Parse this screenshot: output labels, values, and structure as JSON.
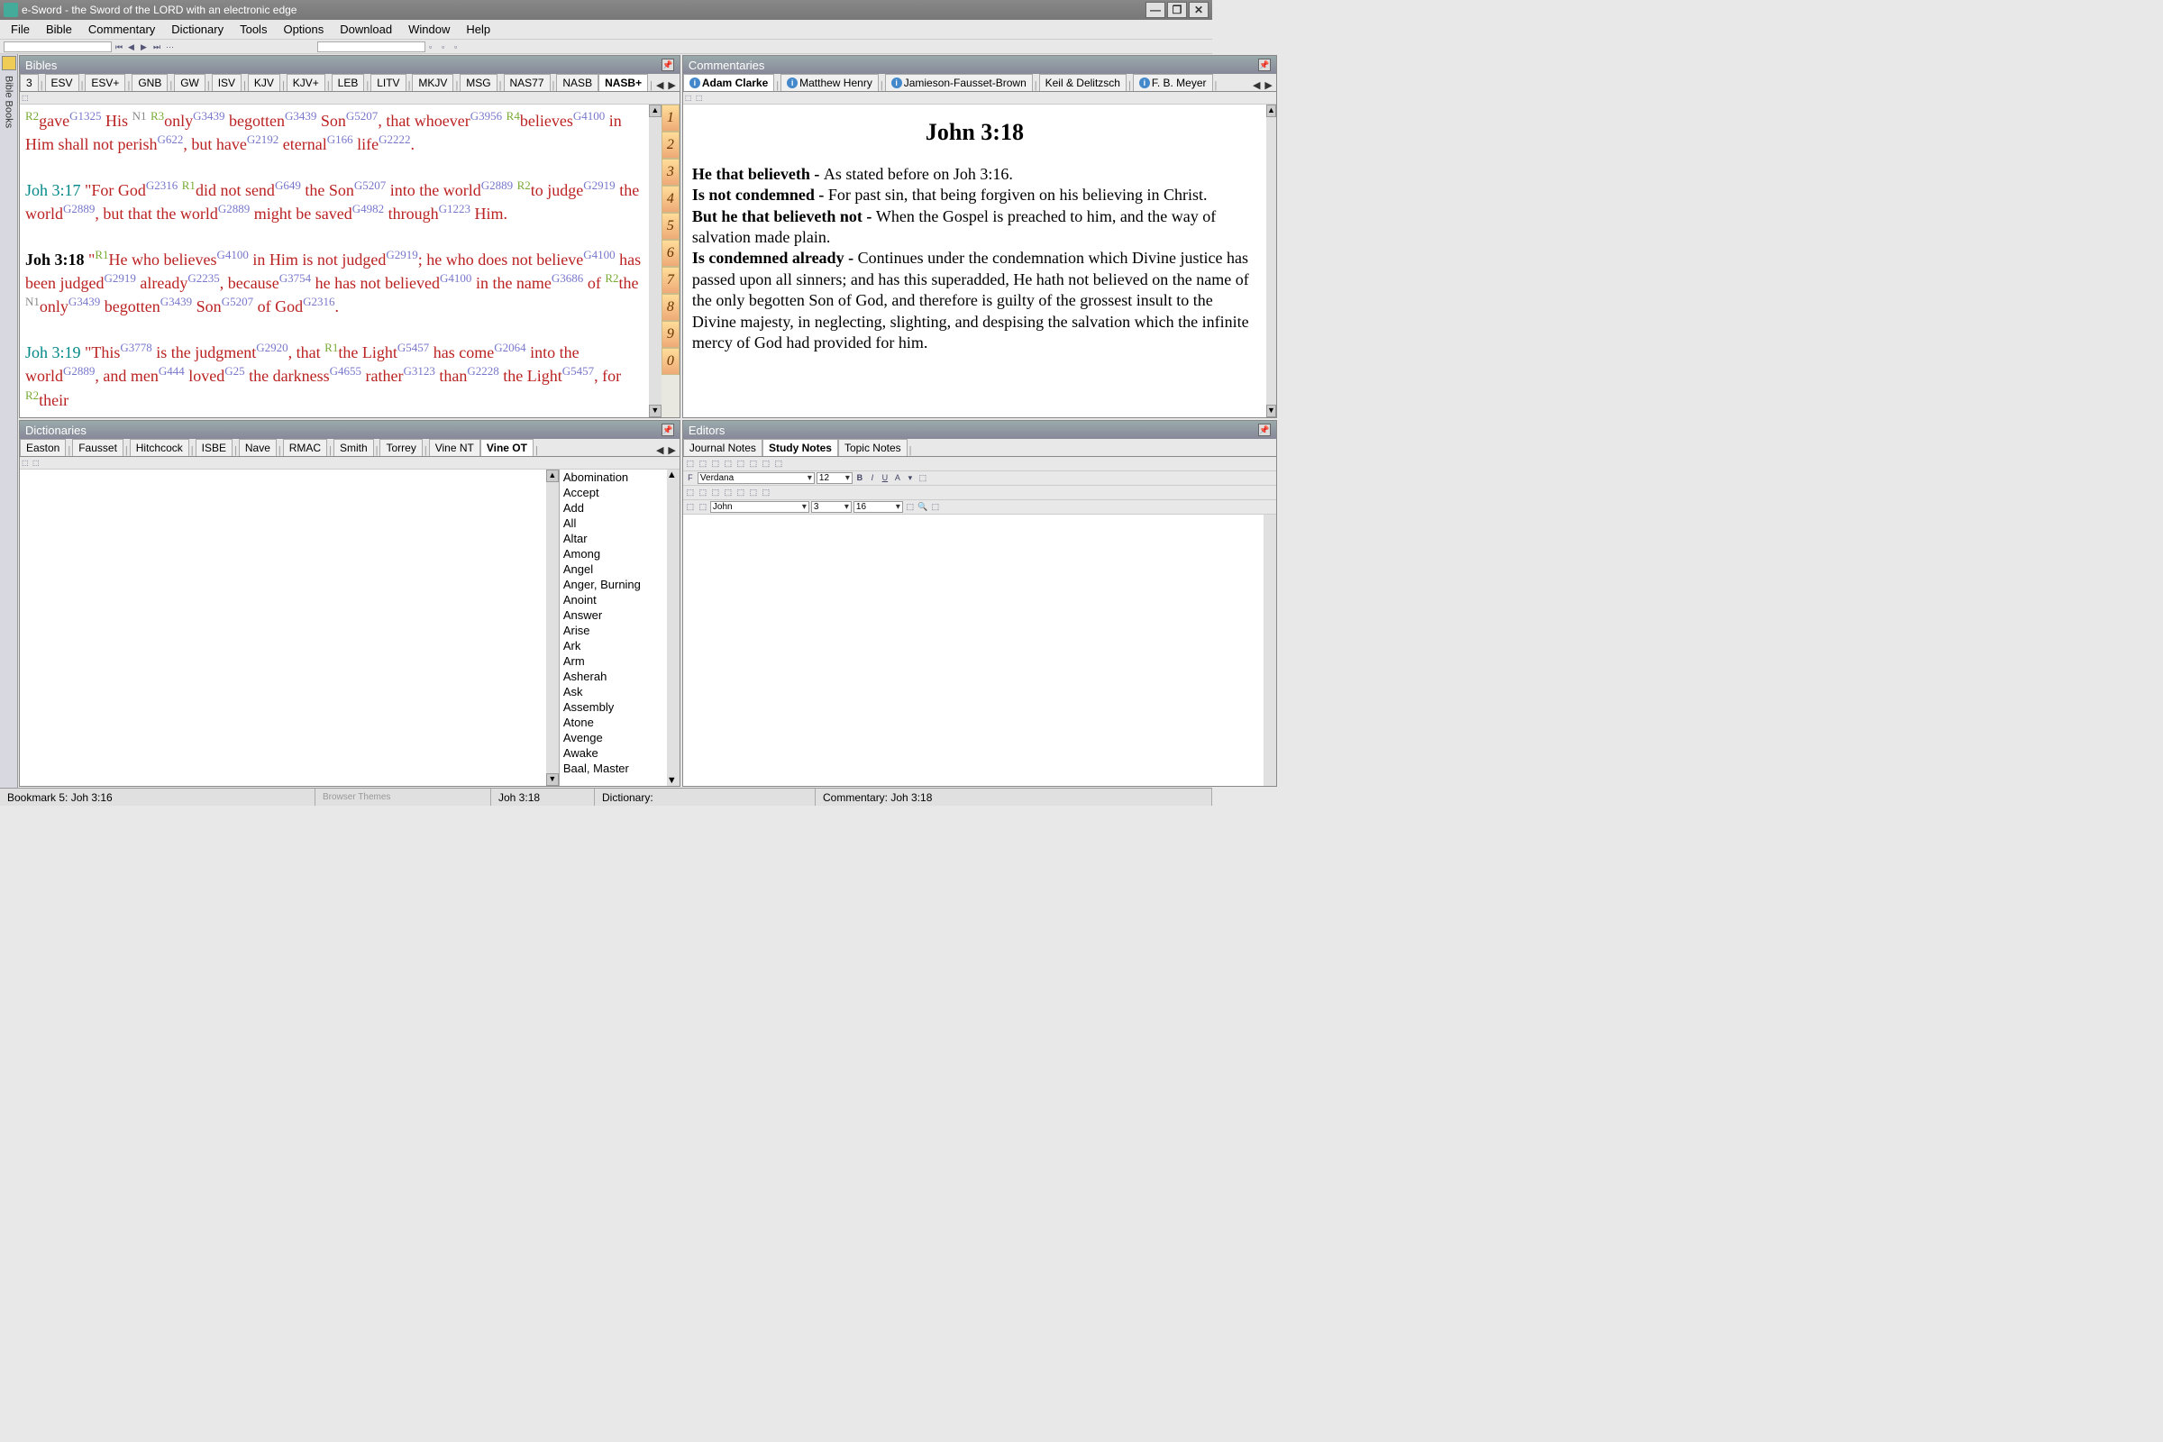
{
  "window": {
    "title": "e-Sword - the Sword of the LORD with an electronic edge"
  },
  "menu": [
    "File",
    "Bible",
    "Commentary",
    "Dictionary",
    "Tools",
    "Options",
    "Download",
    "Window",
    "Help"
  ],
  "panels": {
    "bibles": "Bibles",
    "commentaries": "Commentaries",
    "dictionaries": "Dictionaries",
    "editors": "Editors"
  },
  "sidetab": "Bible Books",
  "bible_tabs": [
    "3",
    "ESV",
    "ESV+",
    "GNB",
    "GW",
    "ISV",
    "KJV",
    "KJV+",
    "LEB",
    "LITV",
    "MKJV",
    "MSG",
    "NAS77",
    "NASB",
    "NASB+"
  ],
  "commentary_tabs": [
    "Adam Clarke",
    "Matthew Henry",
    "Jamieson-Fausset-Brown",
    "Keil & Delitzsch",
    "F. B. Meyer"
  ],
  "dictionary_tabs": [
    "Easton",
    "Fausset",
    "Hitchcock",
    "ISBE",
    "Nave",
    "RMAC",
    "Smith",
    "Torrey",
    "Vine NT",
    "Vine OT"
  ],
  "editor_tabs": [
    "Journal Notes",
    "Study Notes",
    "Topic Notes"
  ],
  "bible_numbers": [
    "1",
    "2",
    "3",
    "4",
    "5",
    "6",
    "7",
    "8",
    "9",
    "0"
  ],
  "verses": {
    "v16a": "gave",
    "v16b": " His ",
    "v16c": "only",
    "v16d": " begotten",
    "v16e": " Son",
    "v16f": ", that whoever",
    "v16g": "believes",
    "v16h": " in Him shall not perish",
    "v16i": ", but have",
    "v16j": " eternal",
    "v16k": " life",
    "v17ref": "Joh 3:17",
    "v17a": "  \"For God",
    "v17b": "did not send",
    "v17c": " the Son",
    "v17d": " into the world",
    "v17e": "to judge",
    "v17f": " the world",
    "v17g": ", but that the world",
    "v17h": " might be saved",
    "v17i": " through",
    "v17j": " Him.",
    "v18ref": "Joh 3:18",
    "v18a": "  \"",
    "v18b": "He who believes",
    "v18c": " in Him is not judged",
    "v18d": "; he who does not believe",
    "v18e": " has been judged",
    "v18f": " already",
    "v18g": ", because",
    "v18h": " he has not believed",
    "v18i": " in the name",
    "v18j": " of ",
    "v18k": "the ",
    "v18l": "only",
    "v18m": " begotten",
    "v18n": " Son",
    "v18o": " of God",
    "v18p": ".",
    "v19ref": "Joh 3:19",
    "v19a": "  \"This",
    "v19b": " is the judgment",
    "v19c": ", that ",
    "v19d": "the Light",
    "v19e": " has come",
    "v19f": " into the world",
    "v19g": ", and men",
    "v19h": " loved",
    "v19i": " the darkness",
    "v19j": " rather",
    "v19k": " than",
    "v19l": " the Light",
    "v19m": ", for ",
    "v19n": "their"
  },
  "strongs": {
    "R2": "R2",
    "G1325": "G1325",
    "N1": "N1",
    "R3": "R3",
    "G3439a": "G3439",
    "G3439b": "G3439",
    "G5207": "G5207",
    "G3956": "G3956",
    "R4": "R4",
    "G4100": "G4100",
    "G622": "G622",
    "G2192": "G2192",
    "G166": "G166",
    "G2222": "G2222",
    "G2316": "G2316",
    "R1": "R1",
    "G649": "G649",
    "G2889": "G2889",
    "G2919": "G2919",
    "G4982": "G4982",
    "G1223": "G1223",
    "G2235": "G2235",
    "G3754": "G3754",
    "G3686": "G3686",
    "G3778": "G3778",
    "G2920": "G2920",
    "G5457": "G5457",
    "G2064": "G2064",
    "G444": "G444",
    "G25": "G25",
    "G4655": "G4655",
    "G3123": "G3123",
    "G2228": "G2228"
  },
  "commentary": {
    "title": "John 3:18",
    "l1a": "He that believeth - ",
    "l1b": "As stated before on Joh 3:16.",
    "l2a": "Is not condemned - ",
    "l2b": "For past sin, that being forgiven on his believing in Christ.",
    "l3a": "But he that believeth not - ",
    "l3b": "When the Gospel is preached to him, and the way of salvation made plain.",
    "l4a": "Is condemned already - ",
    "l4b": "Continues under the condemnation which Divine justice has passed upon all sinners; and has this superadded, He hath not believed on the name of the only begotten Son of God, and therefore is guilty of the grossest insult to the Divine majesty, in neglecting, slighting, and despising the salvation which the infinite mercy of God had provided for him."
  },
  "dict_words": [
    "Abomination",
    "Accept",
    "Add",
    "All",
    "Altar",
    "Among",
    "Angel",
    "Anger, Burning",
    "Anoint",
    "Answer",
    "Arise",
    "Ark",
    "Arm",
    "Asherah",
    "Ask",
    "Assembly",
    "Atone",
    "Avenge",
    "Awake",
    "Baal, Master"
  ],
  "editor": {
    "font": "Verdana",
    "size": "12",
    "book": "John",
    "chapter": "3",
    "verse": "16"
  },
  "status": {
    "bookmark": "Bookmark 5: Joh 3:16",
    "ref": "Joh 3:18",
    "dict": "Dictionary:",
    "comm": "Commentary: Joh 3:18",
    "browser": "Browser Themes"
  }
}
